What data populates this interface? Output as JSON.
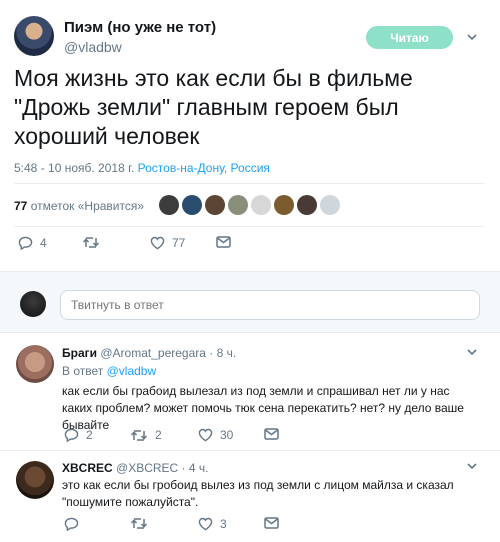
{
  "tweet": {
    "author_name": "Пиэм (но уже не тот)",
    "author_handle": "@vladbw",
    "follow_label": "Читаю",
    "text": "Моя жизнь это как если бы в фильме \"Дрожь земли\" главным героем был хороший человек",
    "timestamp": "5:48 - 10 нояб. 2018 г. ",
    "location": "Ростов-на-Дону, Россия",
    "likes_number": "77",
    "likes_label": " отметок «Нравится»",
    "reply_count": "4",
    "retweet_count": "",
    "like_count": "77"
  },
  "reply_box": {
    "placeholder": "Твитнуть в ответ"
  },
  "replies": [
    {
      "name": "Браги",
      "handle": "@Aromat_peregara · 8 ч.",
      "in_reply_prefix": "В ответ ",
      "in_reply_handle": "@vladbw",
      "text": "как если бы грабоид вылезал из под земли и спрашивал нет ли у нас каких проблем? может помочь тюк сена перекатить? нет? ну дело ваше бывайте",
      "reply_count": "2",
      "retweet_count": "2",
      "like_count": "30"
    },
    {
      "name": "XBCREC",
      "handle": "@XBCREC · 4 ч.",
      "text": "это как если бы гробоид вылез из под земли с лицом майлза и сказал \"пошумите пожалуйста\".",
      "reply_count": "",
      "retweet_count": "",
      "like_count": "3"
    }
  ],
  "colors": {
    "link": "#1da1f2",
    "muted": "#657786",
    "follow_button": "#8fe0c9",
    "divider": "#e6ecf0"
  },
  "icons": [
    "chevron-down-icon",
    "reply-icon",
    "retweet-icon",
    "like-icon",
    "message-icon"
  ]
}
